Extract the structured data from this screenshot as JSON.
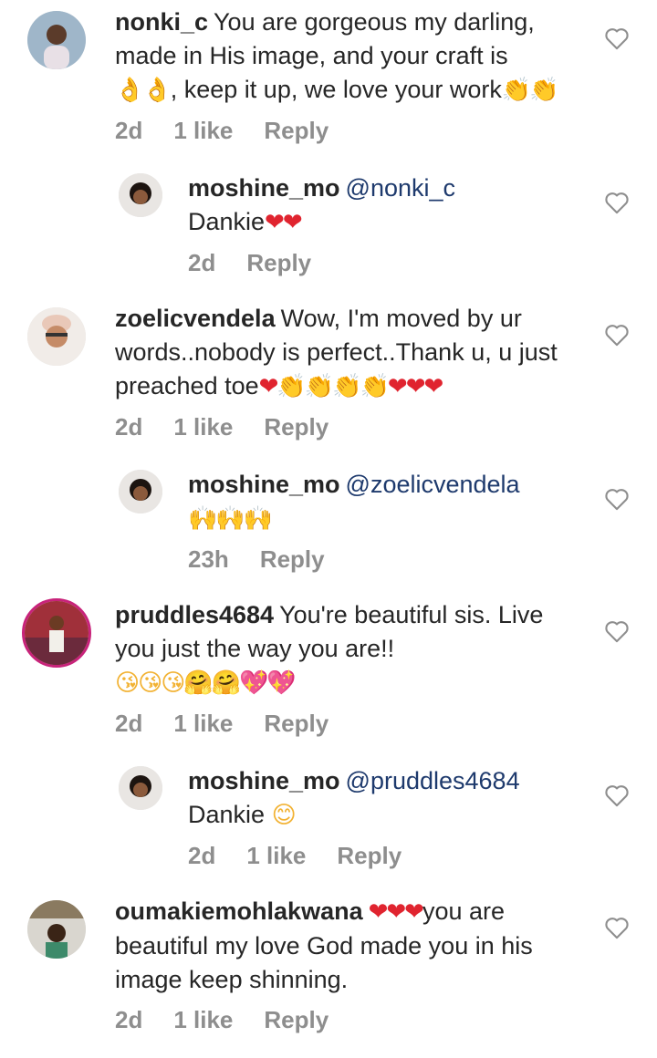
{
  "comments": [
    {
      "username": "nonki_c",
      "line1": "You are gorgeous my darling,",
      "line2": "made in His image, and your craft is",
      "line3_emoji_a": "👌👌",
      "line3_text": ", keep it up, we love your work",
      "line3_emoji_b": "👏👏",
      "time": "2d",
      "likes": "1 like",
      "reply": "Reply"
    },
    {
      "username": "moshine_mo",
      "mention": "@nonki_c",
      "body": "Dankie",
      "body_emoji": "❤❤",
      "time": "2d",
      "reply": "Reply"
    },
    {
      "username": "zoelicvendela",
      "line1": "Wow, I'm moved by ur",
      "line2": "words..nobody is perfect..Thank u, u just",
      "line3_text": "preached toe",
      "line3_emoji": "❤👏👏👏👏❤❤❤",
      "time": "2d",
      "likes": "1 like",
      "reply": "Reply"
    },
    {
      "username": "moshine_mo",
      "mention": "@zoelicvendela",
      "body_emoji": "🙌🙌🙌",
      "time": "23h",
      "reply": "Reply"
    },
    {
      "username": "pruddles4684",
      "line1": "You're beautiful sis. Live",
      "line2": "you just the way you are!!",
      "line3_emoji": "😘😘😘🤗🤗💖💖",
      "time": "2d",
      "likes": "1 like",
      "reply": "Reply"
    },
    {
      "username": "moshine_mo",
      "mention": "@pruddles4684",
      "body": "Dankie",
      "body_emoji": "😊",
      "time": "2d",
      "likes": "1 like",
      "reply": "Reply"
    },
    {
      "username": "oumakiemohlakwana",
      "line1_emoji": "❤❤❤",
      "line1": "you are",
      "line2": "beautiful my love God made you in his",
      "line3": "image keep shinning.",
      "time": "2d",
      "likes": "1 like",
      "reply": "Reply"
    }
  ],
  "icons": {
    "like": "heart-outline-icon"
  },
  "colors": {
    "text": "#262626",
    "meta": "#8e8e8e",
    "mention": "#1e3a6d"
  }
}
